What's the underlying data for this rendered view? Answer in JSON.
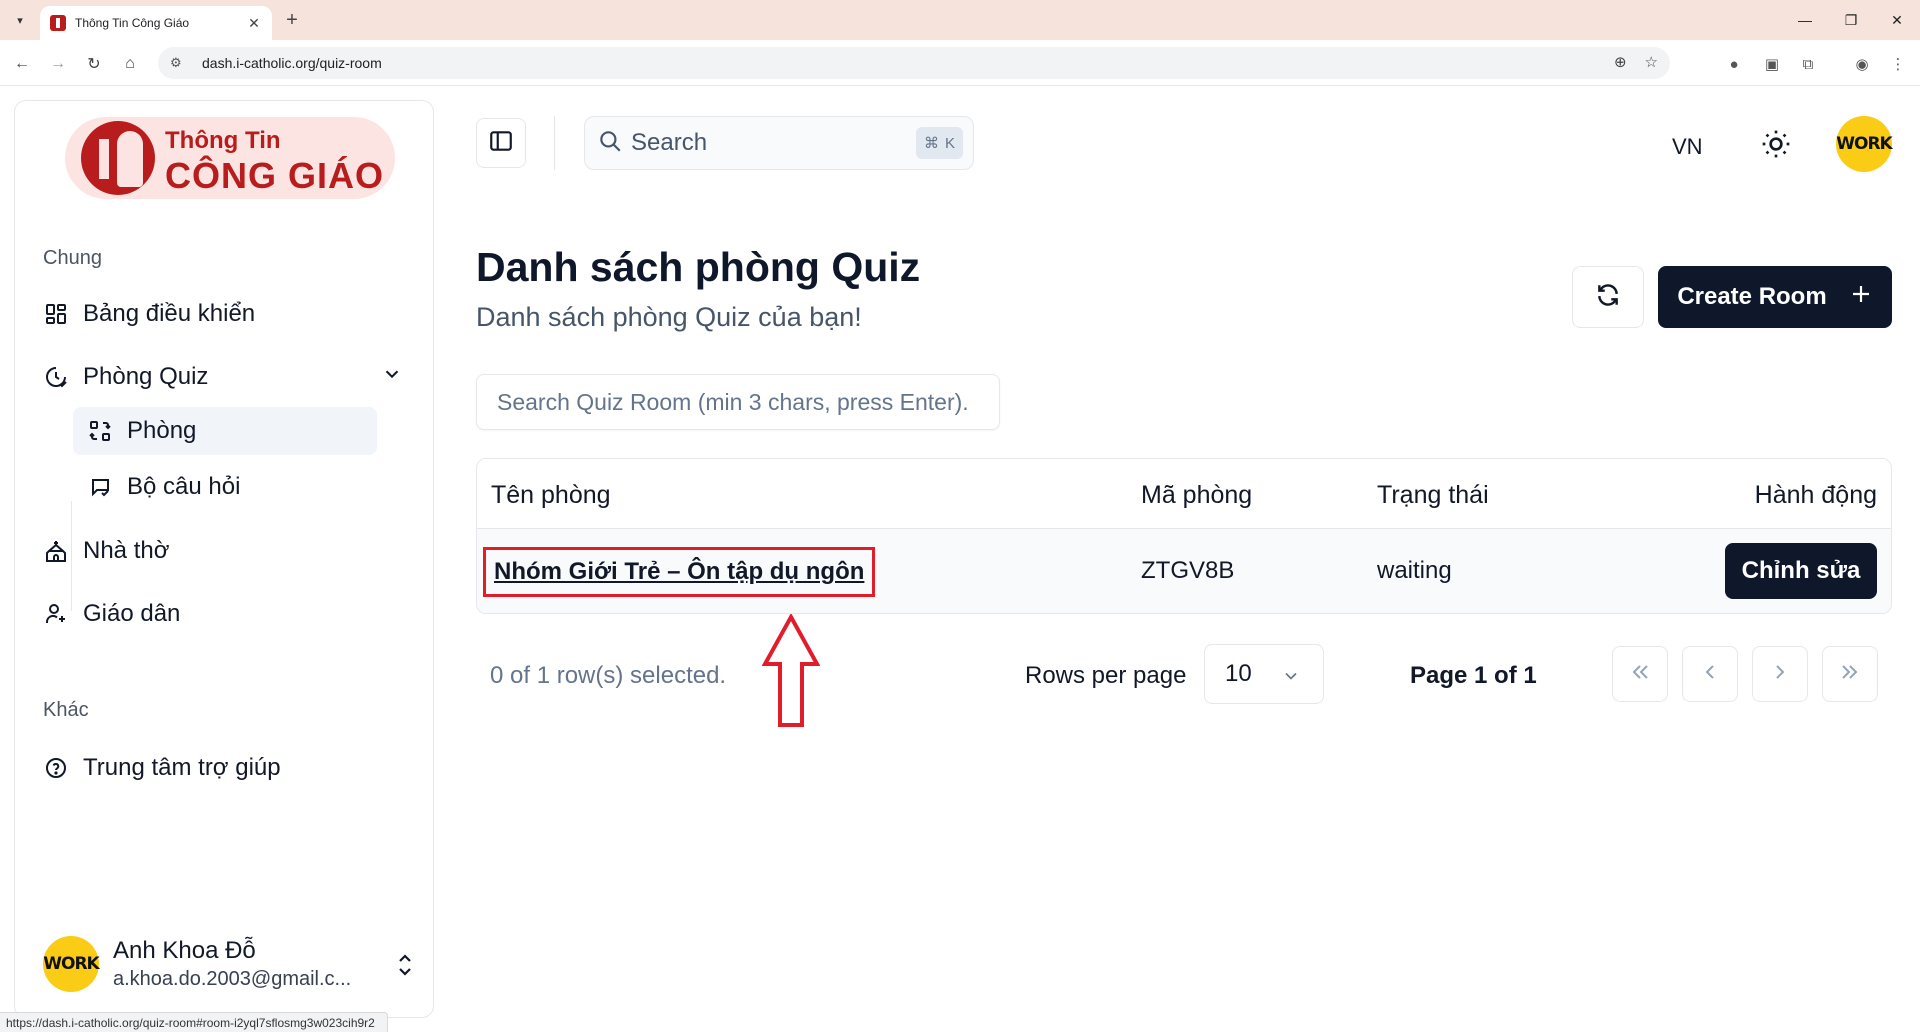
{
  "browser": {
    "tab_title": "Thông Tin Công Giáo",
    "url": "dash.i-catholic.org/quiz-room",
    "status_url": "https://dash.i-catholic.org/quiz-room#room-i2yql7sflosmg3w023cih9r2"
  },
  "logo": {
    "line1": "Thông Tin",
    "line2": "CÔNG GIÁO"
  },
  "sidebar": {
    "group_general": "Chung",
    "dashboard": "Bảng điều khiển",
    "quiz_room": "Phòng Quiz",
    "sub_rooms": "Phòng",
    "sub_question_sets": "Bộ câu hỏi",
    "church": "Nhà thờ",
    "parishioners": "Giáo dân",
    "group_other": "Khác",
    "help_center": "Trung tâm trợ giúp"
  },
  "user": {
    "name": "Anh Khoa Đỗ",
    "email": "a.khoa.do.2003@gmail.c...",
    "avatar_text": "WORK"
  },
  "topbar": {
    "search_placeholder": "Search",
    "shortcut_symbol": "⌘",
    "shortcut_key": "K",
    "language": "VN"
  },
  "main": {
    "title": "Danh sách phòng Quiz",
    "subtitle": "Danh sách phòng Quiz của bạn!",
    "create_button": "Create Room",
    "room_search_placeholder": "Search Quiz Room (min 3 chars, press Enter).",
    "columns": {
      "name": "Tên phòng",
      "code": "Mã phòng",
      "status": "Trạng thái",
      "action": "Hành động"
    },
    "rows": [
      {
        "name": "Nhóm Giới Trẻ – Ôn tập dụ ngôn",
        "code": "ZTGV8B",
        "status": "waiting",
        "action": "Chỉnh sửa"
      }
    ],
    "selected_text": "0 of 1 row(s) selected.",
    "rows_per_page_label": "Rows per page",
    "rows_per_page_value": "10",
    "page_info": "Page 1 of 1"
  },
  "colors": {
    "accent": "#0f172a",
    "brand": "#b91c1c",
    "highlight": "#e11d2b",
    "avatar": "#facc15"
  }
}
